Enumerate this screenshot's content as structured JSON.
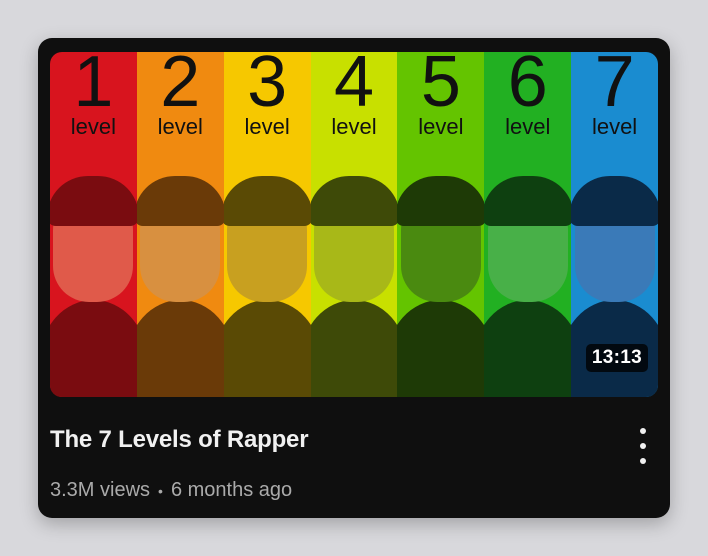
{
  "video": {
    "title": "The 7 Levels of Rapper",
    "views": "3.3M views",
    "separator": "•",
    "age": "6 months ago",
    "duration": "13:13"
  },
  "thumbnail": {
    "level_word": "level",
    "levels": [
      {
        "number": "1",
        "color": "#d8141e",
        "face": "#e05a4a",
        "dark": "#7a0c10"
      },
      {
        "number": "2",
        "color": "#f08a10",
        "face": "#d89040",
        "dark": "#6a3a08"
      },
      {
        "number": "3",
        "color": "#f6c800",
        "face": "#c8a020",
        "dark": "#5a4a05"
      },
      {
        "number": "4",
        "color": "#c8e000",
        "face": "#a8b818",
        "dark": "#3e4a08"
      },
      {
        "number": "5",
        "color": "#64c400",
        "face": "#4a8a10",
        "dark": "#1e3a06"
      },
      {
        "number": "6",
        "color": "#22b022",
        "face": "#48b048",
        "dark": "#0e4010"
      },
      {
        "number": "7",
        "color": "#1a8cd0",
        "face": "#3a7ab8",
        "dark": "#0a2a48"
      }
    ]
  },
  "icons": {
    "more": "more-vertical-icon"
  }
}
